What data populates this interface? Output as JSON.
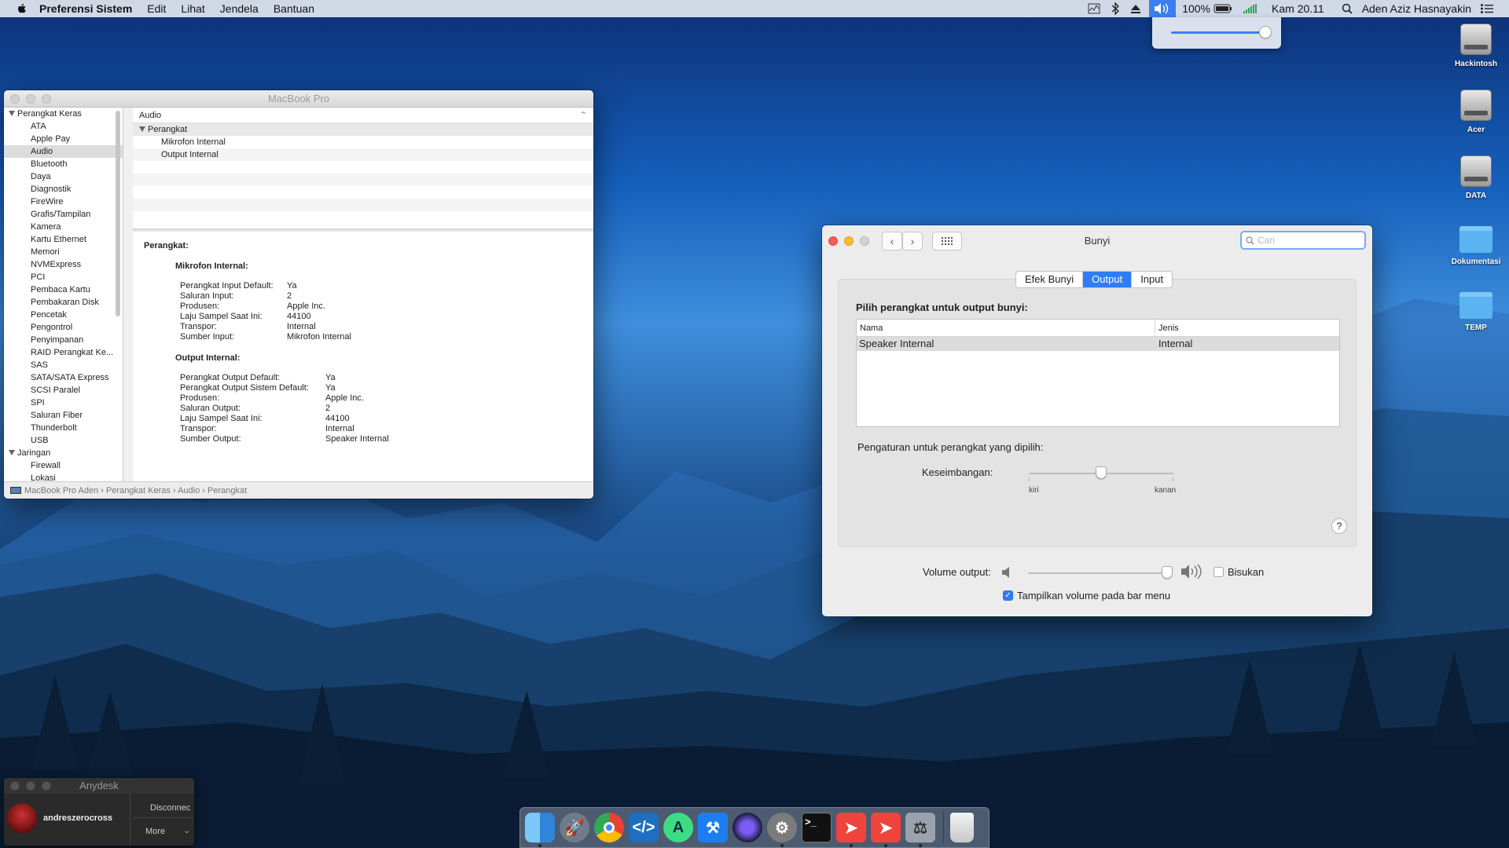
{
  "menubar": {
    "app_name": "Preferensi Sistem",
    "menus": [
      "Edit",
      "Lihat",
      "Jendela",
      "Bantuan"
    ],
    "battery": "100%",
    "clock": "Kam 20.11",
    "user": "Aden Aziz Hasnayakin",
    "volume_level": 1.0
  },
  "desktop": {
    "icons": [
      {
        "label": "Hackintosh",
        "type": "disk"
      },
      {
        "label": "Acer",
        "type": "disk"
      },
      {
        "label": "DATA",
        "type": "disk"
      },
      {
        "label": "Dokumentasi",
        "type": "folder"
      },
      {
        "label": "TEMP",
        "type": "folder"
      }
    ]
  },
  "sysinfo": {
    "title": "MacBook Pro",
    "sidebar": {
      "group1": "Perangkat Keras",
      "items": [
        "ATA",
        "Apple Pay",
        "Audio",
        "Bluetooth",
        "Daya",
        "Diagnostik",
        "FireWire",
        "Grafis/Tampilan",
        "Kamera",
        "Kartu Ethernet",
        "Memori",
        "NVMExpress",
        "PCI",
        "Pembaca Kartu",
        "Pembakaran Disk",
        "Pencetak",
        "Pengontrol",
        "Penyimpanan",
        "RAID Perangkat Ke...",
        "SAS",
        "SATA/SATA Express",
        "SCSI Paralel",
        "SPI",
        "Saluran Fiber",
        "Thunderbolt",
        "USB"
      ],
      "selected": "Audio",
      "group2": "Jaringan",
      "items2": [
        "Firewall",
        "Lokasi"
      ]
    },
    "top": {
      "header": "Audio",
      "group": "Perangkat",
      "rows": [
        "Mikrofon Internal",
        "Output Internal"
      ]
    },
    "detail": {
      "heading": "Perangkat:",
      "mic_title": "Mikrofon Internal:",
      "mic": [
        {
          "k": "Perangkat Input Default:",
          "v": "Ya"
        },
        {
          "k": "Saluran Input:",
          "v": "2"
        },
        {
          "k": "Produsen:",
          "v": "Apple Inc."
        },
        {
          "k": "Laju Sampel Saat Ini:",
          "v": "44100"
        },
        {
          "k": "Transpor:",
          "v": "Internal"
        },
        {
          "k": "Sumber Input:",
          "v": "Mikrofon Internal"
        }
      ],
      "out_title": "Output Internal:",
      "out": [
        {
          "k": "Perangkat Output Default:",
          "v": "Ya"
        },
        {
          "k": "Perangkat Output Sistem Default:",
          "v": "Ya"
        },
        {
          "k": "Produsen:",
          "v": "Apple Inc."
        },
        {
          "k": "Saluran Output:",
          "v": "2"
        },
        {
          "k": "Laju Sampel Saat Ini:",
          "v": "44100"
        },
        {
          "k": "Transpor:",
          "v": "Internal"
        },
        {
          "k": "Sumber Output:",
          "v": "Speaker Internal"
        }
      ]
    },
    "breadcrumb": [
      "MacBook Pro Aden",
      "Perangkat Keras",
      "Audio",
      "Perangkat"
    ]
  },
  "bunyi": {
    "title": "Bunyi",
    "search_placeholder": "Cari",
    "tabs": [
      "Efek Bunyi",
      "Output",
      "Input"
    ],
    "active_tab": "Output",
    "choose_label": "Pilih perangkat untuk output bunyi:",
    "col_name": "Nama",
    "col_type": "Jenis",
    "device_name": "Speaker Internal",
    "device_type": "Internal",
    "settings_label": "Pengaturan untuk perangkat yang dipilih:",
    "balance_label": "Keseimbangan:",
    "balance_left": "kiri",
    "balance_right": "kanan",
    "balance_value": 0.5,
    "help": "?",
    "volume_label": "Volume output:",
    "volume_value": 0.97,
    "mute_label": "Bisukan",
    "mute_checked": false,
    "show_volume_label": "Tampilkan volume pada bar menu",
    "show_volume_checked": true
  },
  "anydesk": {
    "title": "Anydesk",
    "user": "andreszerocross",
    "disconnect": "Disconnec",
    "more": "More"
  },
  "dock": {
    "apps": [
      "Finder",
      "Launchpad",
      "Chrome",
      "Visual Studio Code",
      "Android Studio",
      "Xcode",
      "Siri",
      "System Preferences",
      "Terminal",
      "AnyDesk",
      "AnyDesk",
      "Cleaner",
      "Trash"
    ]
  },
  "colors": {
    "accent": "#2f7cf6",
    "close": "#fc5f57",
    "minimize": "#fdbc2e"
  }
}
